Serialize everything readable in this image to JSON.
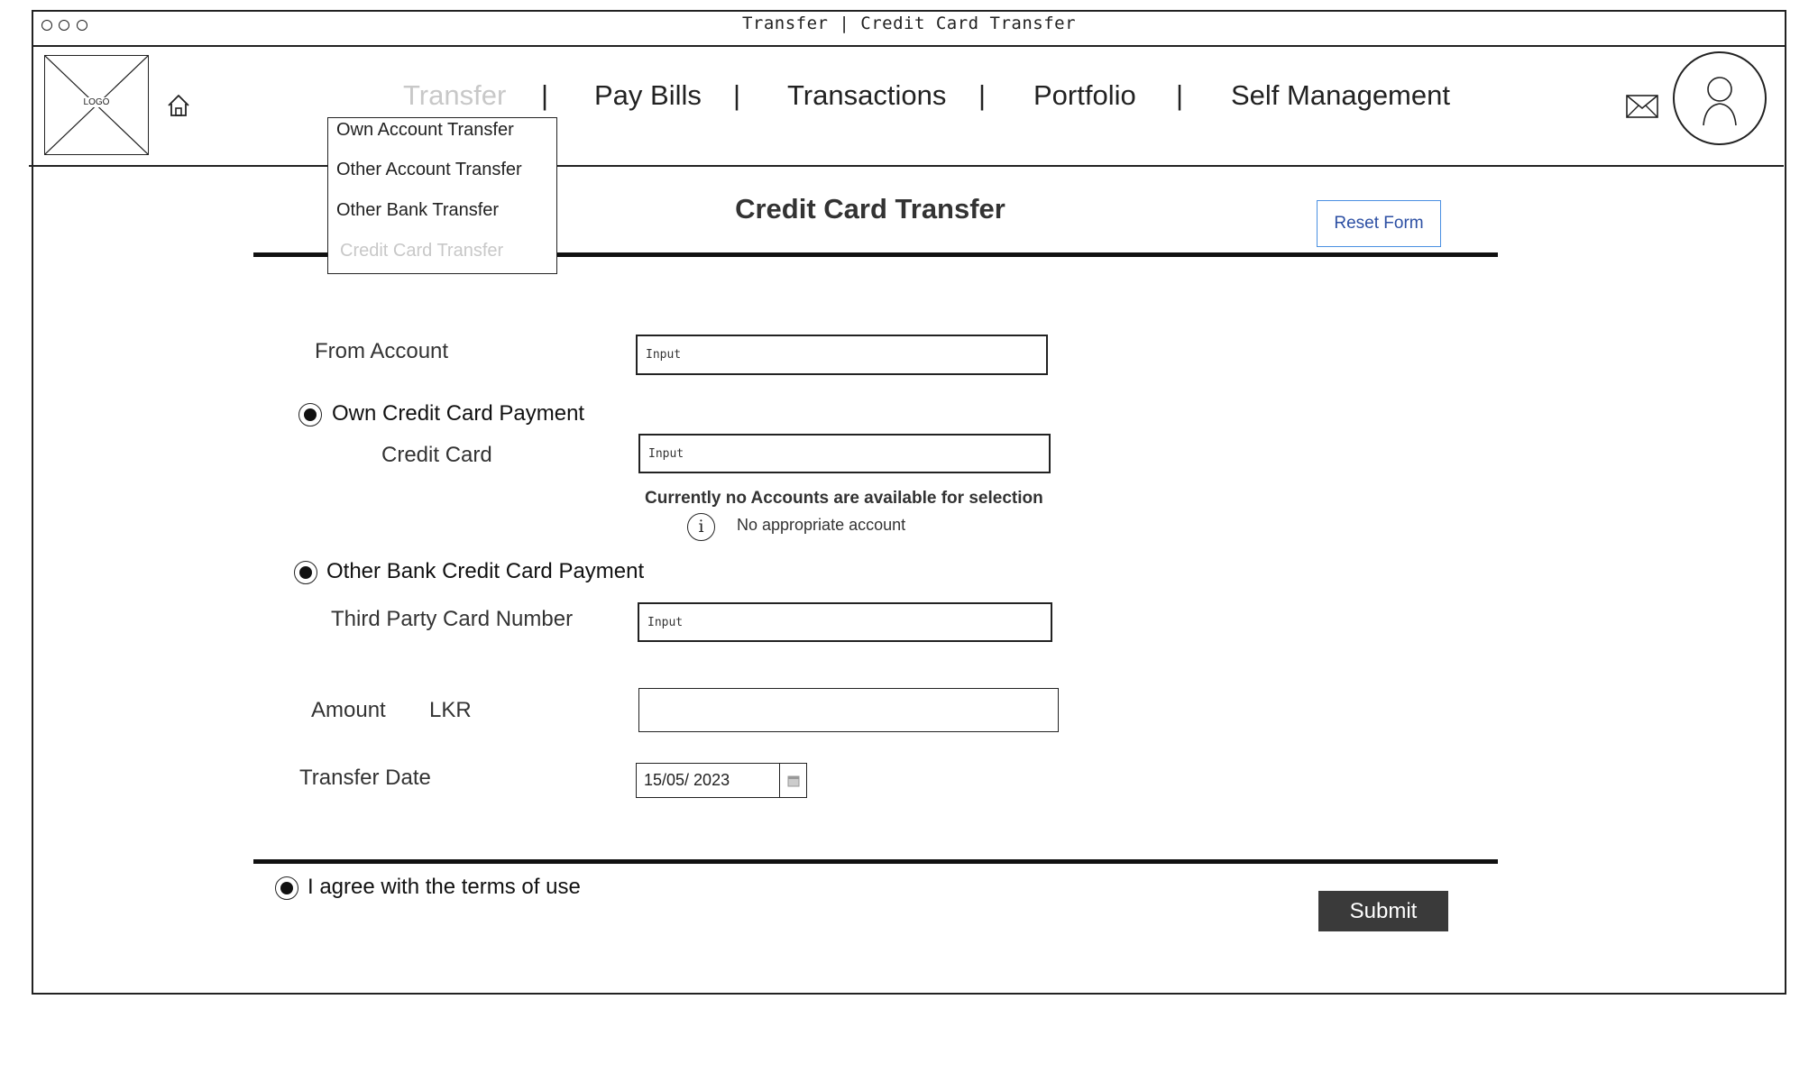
{
  "window": {
    "title": "Transfer | Credit Card Transfer"
  },
  "header": {
    "logo_text": "LOGO",
    "nav": [
      {
        "label": "Transfer",
        "active": true
      },
      {
        "label": "Pay Bills"
      },
      {
        "label": "Transactions"
      },
      {
        "label": "Portfolio"
      },
      {
        "label": "Self Management"
      }
    ],
    "separator": "|",
    "icons": [
      "home-icon",
      "mail-icon",
      "user-avatar-icon"
    ]
  },
  "dropdown": {
    "items": [
      {
        "label": "Own Account Transfer"
      },
      {
        "label": "Other Account Transfer"
      },
      {
        "label": "Other Bank Transfer"
      },
      {
        "label": "Credit Card Transfer",
        "disabled": true
      }
    ]
  },
  "form": {
    "title": "Credit Card Transfer",
    "reset_label": "Reset Form",
    "from_account": {
      "label": "From Account",
      "value": "Input"
    },
    "own_card_payment": {
      "label": "Own Credit Card Payment",
      "credit_card_label": "Credit Card",
      "credit_card_value": "Input",
      "warning_title": "Currently no Accounts are available for selection",
      "warning_text": "No appropriate account",
      "info_glyph": "i"
    },
    "other_bank_payment": {
      "label": "Other Bank Credit Card Payment",
      "card_number_label": "Third Party Card Number",
      "card_number_value": "Input"
    },
    "amount": {
      "label": "Amount",
      "currency": "LKR",
      "value": ""
    },
    "transfer_date": {
      "label": "Transfer Date",
      "value": "15/05/ 2023"
    },
    "terms_label": "I agree with the terms of use",
    "submit_label": "Submit"
  },
  "colors": {
    "inactive_nav": "#c8c8c8",
    "reset_border": "#4a90e2",
    "reset_text": "#2c4fa3",
    "submit_bg": "#3a3a3a"
  }
}
